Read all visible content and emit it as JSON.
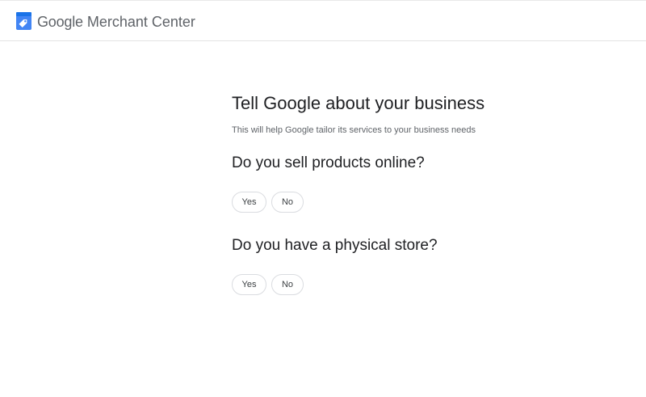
{
  "header": {
    "logo_icon": "merchant-center-tag-icon",
    "brand_google": "Google",
    "brand_product": "Merchant Center",
    "colors": {
      "logo_blue": "#4285f4",
      "logo_dark_blue": "#1a73e8"
    }
  },
  "main": {
    "title": "Tell Google about your business",
    "subtitle": "This will help Google tailor its services to your business needs",
    "questions": [
      {
        "text": "Do you sell products online?",
        "options": [
          "Yes",
          "No"
        ]
      },
      {
        "text": "Do you have a physical store?",
        "options": [
          "Yes",
          "No"
        ]
      }
    ]
  }
}
